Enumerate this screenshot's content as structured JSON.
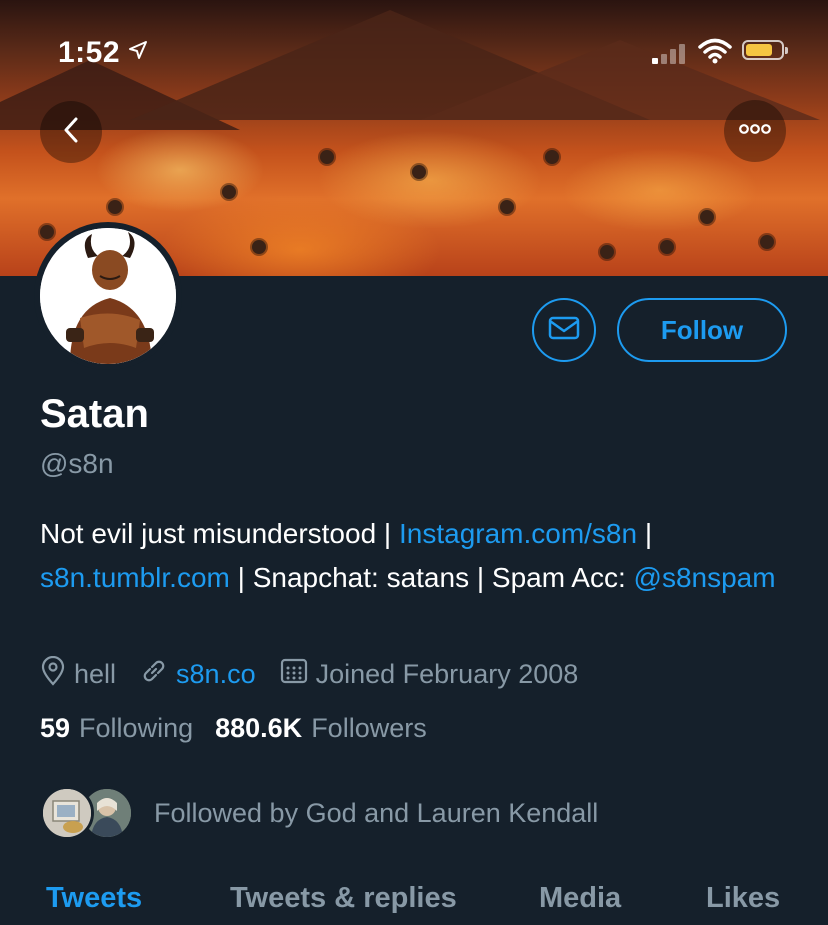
{
  "status_bar": {
    "time": "1:52"
  },
  "profile": {
    "name": "Satan",
    "handle": "@s8n",
    "bio_text_1": "Not evil just misunderstood | ",
    "bio_link_1": "Instagram.com/s8n",
    "bio_text_2": " | ",
    "bio_link_2": "s8n.tumblr.com",
    "bio_text_3": " | Snapchat: satans | Spam Acc: ",
    "bio_link_3": "@s8nspam",
    "location": "hell",
    "website": "s8n.co",
    "joined": "Joined February 2008",
    "following_count": "59",
    "following_label": "Following",
    "followers_count": "880.6K",
    "followers_label": "Followers",
    "followed_by": "Followed by God and Lauren Kendall"
  },
  "actions": {
    "follow_label": "Follow"
  },
  "tabs": [
    {
      "label": "Tweets",
      "active": true
    },
    {
      "label": "Tweets & replies",
      "active": false
    },
    {
      "label": "Media",
      "active": false
    },
    {
      "label": "Likes",
      "active": false
    }
  ],
  "colors": {
    "background": "#15202b",
    "accent": "#1d9bf0",
    "muted": "#8899a6",
    "battery": "#f5c542"
  },
  "icons": [
    "back-arrow-icon",
    "more-icon",
    "location-arrow-icon",
    "signal-icon",
    "wifi-icon",
    "battery-icon",
    "envelope-icon",
    "location-pin-icon",
    "link-icon",
    "calendar-icon"
  ]
}
